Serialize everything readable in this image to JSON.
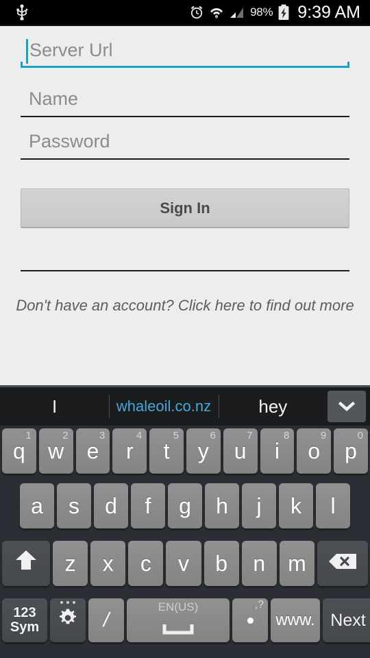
{
  "status_bar": {
    "usb_icon": "usb-icon",
    "alarm_icon": "alarm-clock-icon",
    "wifi_icon": "wifi-icon",
    "signal_icon": "cellular-signal-icon",
    "battery_percent": "98%",
    "battery_icon": "battery-charging-icon",
    "time": "9:39 AM"
  },
  "form": {
    "server_url": {
      "placeholder": "Server Url",
      "value": "",
      "focused": true
    },
    "name": {
      "placeholder": "Name",
      "value": ""
    },
    "password": {
      "placeholder": "Password",
      "value": ""
    },
    "sign_in_label": "Sign In",
    "signup_text": "Don't have an account? Click here to find out more"
  },
  "colors": {
    "accent_blue": "#1b9ec6",
    "suggestion_link": "#4aa5d8",
    "app_background": "#eceded",
    "keyboard_background": "#2b2e34"
  },
  "keyboard": {
    "suggestions": [
      {
        "text": "I",
        "link": false
      },
      {
        "text": "whaleoil.co.nz",
        "link": true
      },
      {
        "text": "hey",
        "link": false
      }
    ],
    "expand_icon": "chevron-down-icon",
    "row1": [
      {
        "key": "q",
        "num": "1"
      },
      {
        "key": "w",
        "num": "2"
      },
      {
        "key": "e",
        "num": "3"
      },
      {
        "key": "r",
        "num": "4"
      },
      {
        "key": "t",
        "num": "5"
      },
      {
        "key": "y",
        "num": "6"
      },
      {
        "key": "u",
        "num": "7"
      },
      {
        "key": "i",
        "num": "8"
      },
      {
        "key": "o",
        "num": "9"
      },
      {
        "key": "p",
        "num": "0"
      }
    ],
    "row2": [
      {
        "key": "a"
      },
      {
        "key": "s"
      },
      {
        "key": "d"
      },
      {
        "key": "f"
      },
      {
        "key": "g"
      },
      {
        "key": "h"
      },
      {
        "key": "j"
      },
      {
        "key": "k"
      },
      {
        "key": "l"
      }
    ],
    "row3": {
      "shift_icon": "shift-arrow-icon",
      "letters": [
        {
          "key": "z"
        },
        {
          "key": "x"
        },
        {
          "key": "c"
        },
        {
          "key": "v"
        },
        {
          "key": "b"
        },
        {
          "key": "n"
        },
        {
          "key": "m"
        }
      ],
      "backspace_icon": "backspace-icon"
    },
    "row4": {
      "symbols_line1": "123",
      "symbols_line2": "Sym",
      "settings_icon": "gear-icon",
      "slash": "/",
      "space_label": "EN(US)",
      "space_icon": "space-bar-icon",
      "period_sup": ",?",
      "period": ".",
      "www": "www.",
      "next": "Next"
    }
  }
}
